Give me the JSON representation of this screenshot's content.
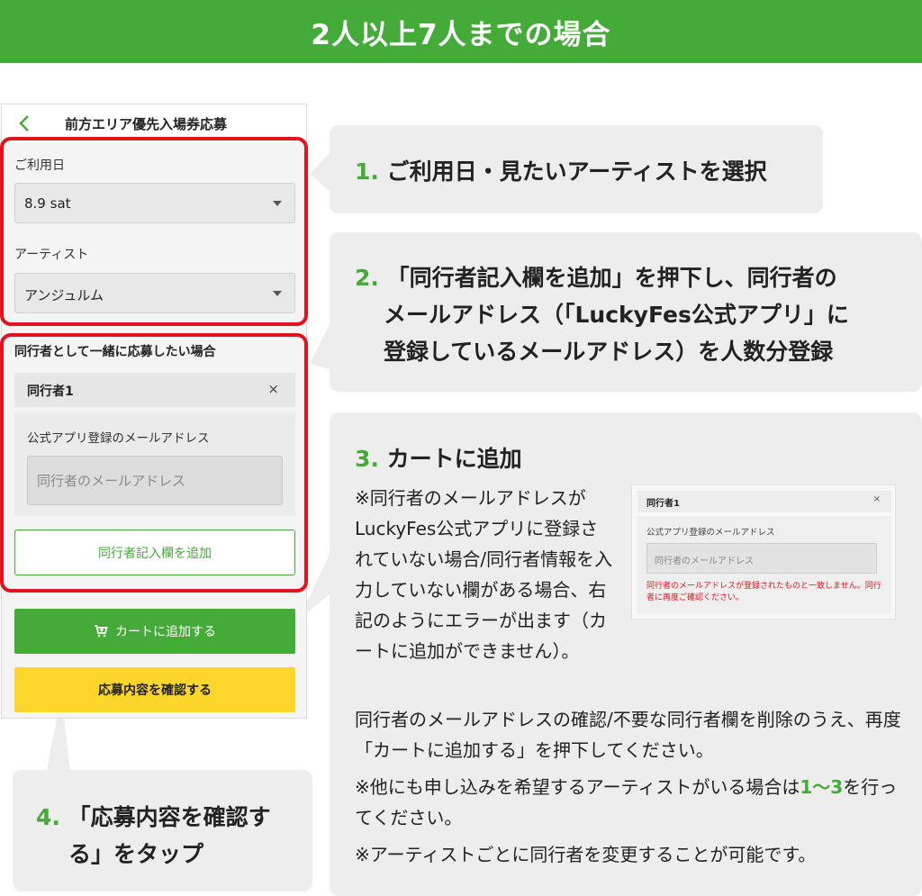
{
  "banner": {
    "title": "2人以上7人までの場合"
  },
  "phone": {
    "title": "前方エリア優先入場券応募",
    "date": {
      "label": "ご利用日",
      "value": "8.9 sat"
    },
    "artist": {
      "label": "アーティスト",
      "value": "アンジュルム"
    },
    "companion_section": {
      "heading": "同行者として一緒に応募したい場合",
      "companion_label": "同行者1",
      "close_glyph": "×",
      "email_label": "公式アプリ登録のメールアドレス",
      "email_placeholder": "同行者のメールアドレス",
      "add_field_label": "同行者記入欄を追加"
    },
    "cart_button": "カートに追加する",
    "confirm_button": "応募内容を確認する"
  },
  "callouts": {
    "step1": {
      "num": "1.",
      "text": "ご利用日・見たいアーティストを選択"
    },
    "step2": {
      "num": "2.",
      "line1": "「同行者記入欄を追加」を押下し、同行者の",
      "line2": "メールアドレス（「LuckyFes公式アプリ」に",
      "line3": "登録しているメールアドレス）を人数分登録"
    },
    "step3": {
      "num": "3.",
      "title": "カートに追加",
      "note": "※同行者のメールアドレスがLuckyFes公式アプリに登録されていない場合/同行者情報を入力していない欄がある場合、右記のようにエラーが出ます（カートに追加ができません）。",
      "instruction": "同行者のメールアドレスの確認/不要な同行者欄を削除のうえ、再度「カートに追加する」を押下してください。",
      "note2_a": "※他にも申し込みを希望するアーティストがいる場合は",
      "note2_range": "1〜3",
      "note2_b": "を行ってください。",
      "note3": "※アーティストごとに同行者を変更することが可能です。",
      "preview": {
        "companion_label": "同行者1",
        "close_glyph": "×",
        "email_label": "公式アプリ登録のメールアドレス",
        "email_placeholder": "同行者のメールアドレス",
        "error": "同行者のメールアドレスが登録されたものと一致しません。同行者に再度ご確認ください。"
      }
    },
    "step4": {
      "num": "4.",
      "line1": "「応募内容を確認す",
      "line2": "る」をタップ"
    }
  },
  "colors": {
    "brand_green": "#44ab38",
    "highlight_red": "#e2131f",
    "confirm_yellow": "#fcd62a"
  }
}
